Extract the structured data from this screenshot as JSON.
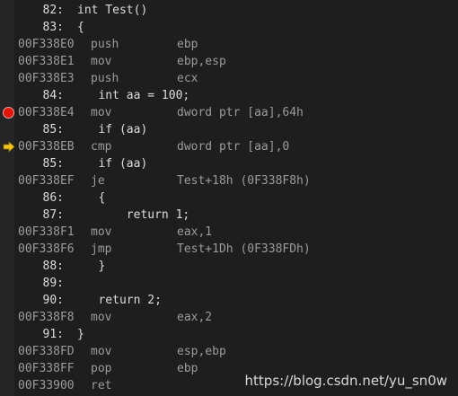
{
  "lines": [
    {
      "type": "source",
      "num": "82:",
      "text": "int Test()"
    },
    {
      "type": "source",
      "num": "83:",
      "text": "{"
    },
    {
      "type": "asm",
      "addr": "00F338E0",
      "mnem": "push",
      "ops": "ebp"
    },
    {
      "type": "asm",
      "addr": "00F338E1",
      "mnem": "mov",
      "ops": "ebp,esp"
    },
    {
      "type": "asm",
      "addr": "00F338E3",
      "mnem": "push",
      "ops": "ecx"
    },
    {
      "type": "source",
      "num": "84:",
      "text": "   int aa = 100;"
    },
    {
      "type": "asm",
      "addr": "00F338E4",
      "mnem": "mov",
      "ops": "dword ptr [aa],64h",
      "marker": "breakpoint"
    },
    {
      "type": "source",
      "num": "85:",
      "text": "   if (aa)"
    },
    {
      "type": "asm",
      "addr": "00F338EB",
      "mnem": "cmp",
      "ops": "dword ptr [aa],0",
      "marker": "current-instruction"
    },
    {
      "type": "source",
      "num": "85:",
      "text": "   if (aa)"
    },
    {
      "type": "asm",
      "addr": "00F338EF",
      "mnem": "je",
      "ops": "Test+18h (0F338F8h)"
    },
    {
      "type": "source",
      "num": "86:",
      "text": "   {"
    },
    {
      "type": "source",
      "num": "87:",
      "text": "       return 1;"
    },
    {
      "type": "asm",
      "addr": "00F338F1",
      "mnem": "mov",
      "ops": "eax,1"
    },
    {
      "type": "asm",
      "addr": "00F338F6",
      "mnem": "jmp",
      "ops": "Test+1Dh (0F338FDh)"
    },
    {
      "type": "source",
      "num": "88:",
      "text": "   }"
    },
    {
      "type": "source",
      "num": "89:",
      "text": ""
    },
    {
      "type": "source",
      "num": "90:",
      "text": "   return 2;"
    },
    {
      "type": "asm",
      "addr": "00F338F8",
      "mnem": "mov",
      "ops": "eax,2"
    },
    {
      "type": "source",
      "num": "91:",
      "text": "}"
    },
    {
      "type": "asm",
      "addr": "00F338FD",
      "mnem": "mov",
      "ops": "esp,ebp"
    },
    {
      "type": "asm",
      "addr": "00F338FF",
      "mnem": "pop",
      "ops": "ebp"
    },
    {
      "type": "asm",
      "addr": "00F33900",
      "mnem": "ret",
      "ops": ""
    }
  ],
  "watermark": "https://blog.csdn.net/yu_sn0w",
  "colors": {
    "background": "#1e1e1e",
    "gutter": "#252526",
    "source_text": "#dcdcdc",
    "asm_text": "#9b9b9b",
    "breakpoint": "#e51400",
    "current_arrow": "#f5c518"
  }
}
